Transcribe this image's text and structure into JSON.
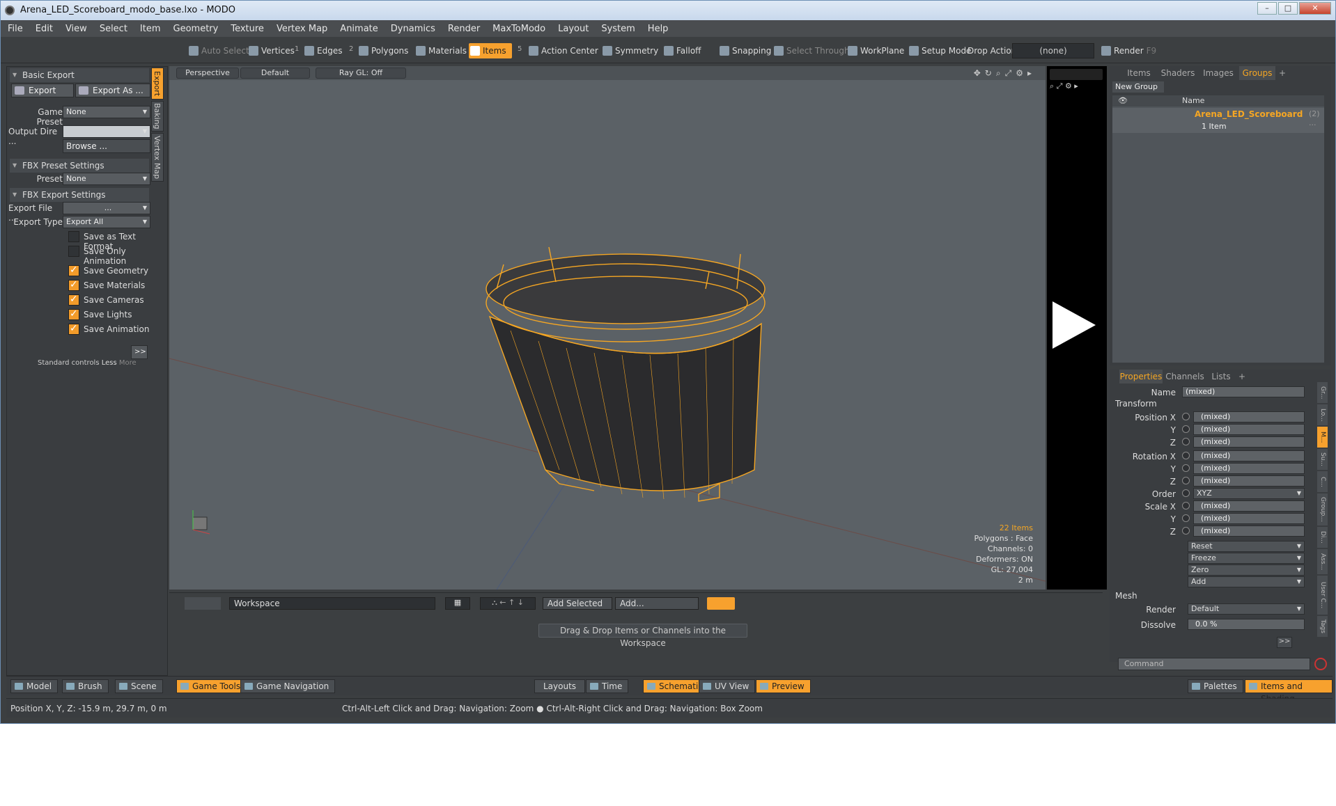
{
  "window": {
    "title": "Arena_LED_Scoreboard_modo_base.lxo - MODO",
    "controls": [
      "–",
      "□",
      "✕"
    ]
  },
  "menu": [
    "File",
    "Edit",
    "View",
    "Select",
    "Item",
    "Geometry",
    "Texture",
    "Vertex Map",
    "Animate",
    "Dynamics",
    "Render",
    "MaxToModo",
    "Layout",
    "System",
    "Help"
  ],
  "toolbar": {
    "auto_select": "Auto Select",
    "vertices": "Vertices",
    "vertices_count": "1",
    "edges": "Edges",
    "edges_count": "2",
    "polygons": "Polygons",
    "materials": "Materials",
    "items": "Items",
    "items_count": "5",
    "action_center": "Action Center",
    "symmetry": "Symmetry",
    "falloff": "Falloff",
    "snapping": "Snapping",
    "select_through": "Select Through",
    "workplane": "WorkPlane",
    "setup_mode": "Setup Mode",
    "drop_action": "Drop Action",
    "drop_action_value": "(none)",
    "render": "Render",
    "render_shortcut": "F9"
  },
  "left_panel": {
    "side_tabs": [
      "Export",
      "Baking",
      "Vertex Map"
    ],
    "basic_export": "Basic Export",
    "export_btn": "Export",
    "export_as_btn": "Export As ...",
    "game_preset_label": "Game Preset",
    "game_preset_value": "None",
    "output_dir_label": "Output Dire ...",
    "output_dir_value": "",
    "browse_btn": "Browse ...",
    "fbx_preset_settings": "FBX Preset Settings",
    "preset_label": "Preset",
    "preset_value": "None",
    "fbx_export_settings": "FBX Export Settings",
    "export_file_label": "Export File ...",
    "export_file_value": "...",
    "export_type_label": "Export Type",
    "export_type_value": "Export All",
    "options": [
      {
        "label": "Save as Text Format",
        "checked": false
      },
      {
        "label": "Save Only Animation",
        "checked": false
      },
      {
        "label": "Save Geometry",
        "checked": true
      },
      {
        "label": "Save Materials",
        "checked": true
      },
      {
        "label": "Save Cameras",
        "checked": true
      },
      {
        "label": "Save Lights",
        "checked": true
      },
      {
        "label": "Save Animation",
        "checked": true
      }
    ],
    "more_btn": ">>",
    "std_controls": "Standard controls",
    "less": "Less",
    "more": "More"
  },
  "viewport": {
    "view": "Perspective",
    "shading": "Default",
    "raygl": "Ray GL: Off",
    "hud": {
      "items": "22 Items",
      "polygons": "Polygons : Face",
      "channels": "Channels: 0",
      "deformers": "Deformers: ON",
      "gl": "GL: 27,004",
      "scale": "2 m"
    }
  },
  "right_panel": {
    "tabs": [
      "Items",
      "Shaders",
      "Images",
      "Groups",
      "+"
    ],
    "new_group": "New Group",
    "name_col": "Name",
    "group_name": "Arena_LED_Scoreboard",
    "group_count": "(2) ...",
    "group_items": "1 Item"
  },
  "properties": {
    "tabs": [
      "Properties",
      "Channels",
      "Lists",
      "+"
    ],
    "name_label": "Name",
    "name_value": "(mixed)",
    "transform": "Transform",
    "position_x": "Position X",
    "rotation_x": "Rotation X",
    "scale_x": "Scale X",
    "y": "Y",
    "z": "Z",
    "mixed": "(mixed)",
    "order_label": "Order",
    "order_value": "XYZ",
    "reset": "Reset",
    "freeze": "Freeze",
    "zero": "Zero",
    "add": "Add",
    "mesh": "Mesh",
    "render_label": "Render",
    "render_value": "Default",
    "dissolve_label": "Dissolve",
    "dissolve_value": "0.0 %",
    "side_tabs": [
      "Gr...",
      "Lo...",
      "M...",
      "Su...",
      "C...",
      "Group...",
      "Di...",
      "Ass...",
      "User C...",
      "Tags"
    ],
    "more": ">>"
  },
  "workspace": {
    "name": "Workspace",
    "add_selected": "Add Selected",
    "add": "Add...",
    "hint": "Drag & Drop Items or Channels into the Workspace"
  },
  "command": {
    "placeholder": "Command"
  },
  "bottom": {
    "model": "Model",
    "brush": "Brush",
    "scene": "Scene",
    "game_tools": "Game Tools",
    "game_navigation": "Game Navigation",
    "layouts": "Layouts",
    "time": "Time",
    "schematic": "Schematic",
    "uv_view": "UV View",
    "preview": "Preview",
    "palettes": "Palettes",
    "items_shading": "Items and Shading"
  },
  "status": {
    "position": "Position X, Y, Z:  -15.9 m, 29.7 m, 0 m",
    "hint": "Ctrl-Alt-Left Click and Drag: Navigation: Zoom ● Ctrl-Alt-Right Click and Drag: Navigation: Box Zoom"
  }
}
